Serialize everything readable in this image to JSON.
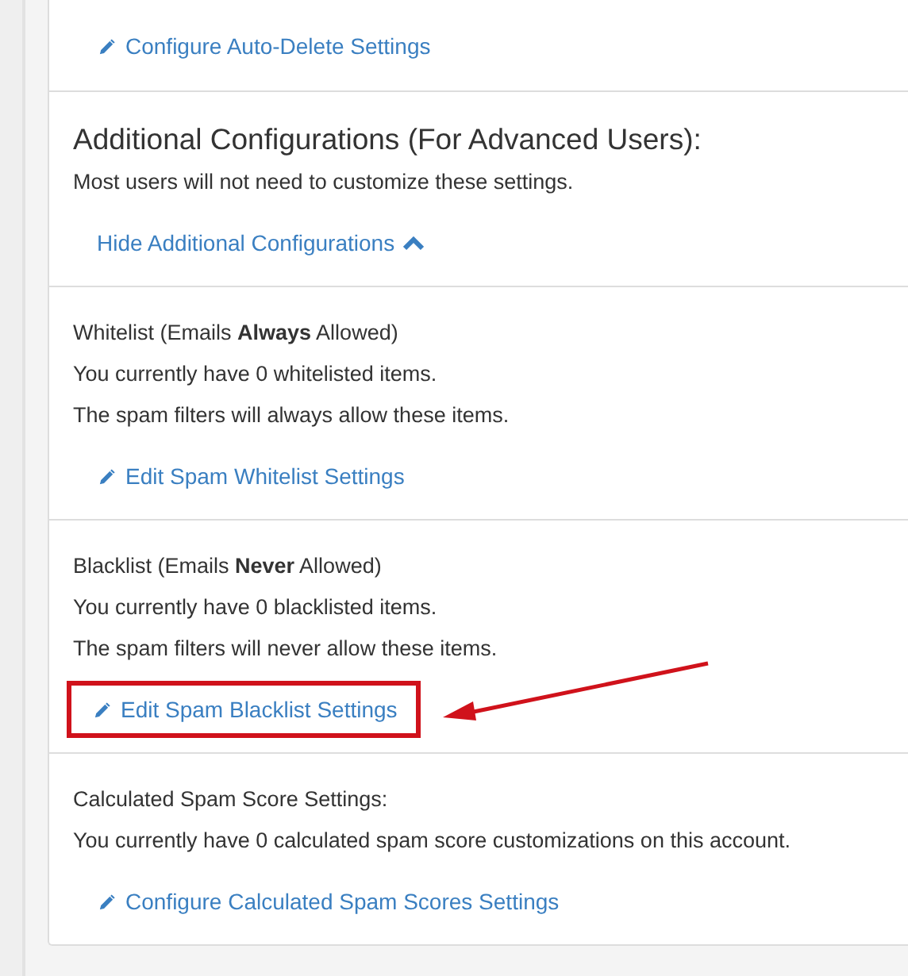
{
  "sections": [
    {
      "link": {
        "label": "Configure Auto-Delete Settings",
        "kind": "edit",
        "highlighted": false
      }
    },
    {
      "kind": "heading",
      "title": "Additional Configurations (For Advanced Users):",
      "lines": [
        "Most users will not need to customize these settings."
      ],
      "link": {
        "label": "Hide Additional Configurations",
        "kind": "collapse",
        "highlighted": false
      }
    },
    {
      "kind": "label",
      "title": "Whitelist (Emails **Always** Allowed)",
      "lines": [
        "You currently have 0 whitelisted items.",
        "The spam filters will always allow these items."
      ],
      "link": {
        "label": "Edit Spam Whitelist Settings",
        "kind": "edit",
        "highlighted": false
      }
    },
    {
      "kind": "label",
      "title": "Blacklist (Emails **Never** Allowed)",
      "lines": [
        "You currently have 0 blacklisted items.",
        "The spam filters will never allow these items."
      ],
      "link": {
        "label": "Edit Spam Blacklist Settings",
        "kind": "edit",
        "highlighted": true
      }
    },
    {
      "kind": "label",
      "title": "Calculated Spam Score Settings:",
      "lines": [
        "You currently have 0 calculated spam score customizations on this account."
      ],
      "link": {
        "label": "Configure Calculated Spam Scores Settings",
        "kind": "edit",
        "highlighted": false
      }
    }
  ]
}
